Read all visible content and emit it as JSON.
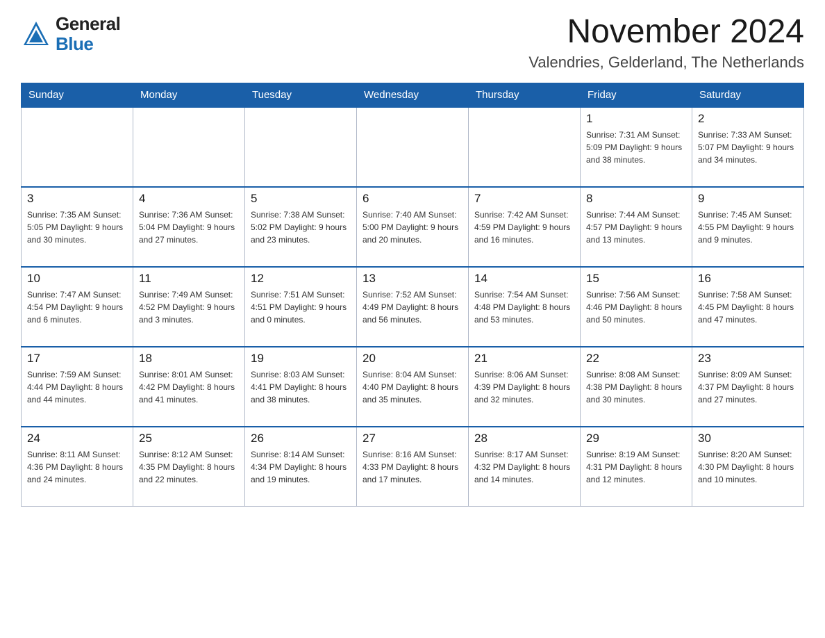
{
  "logo": {
    "line1": "General",
    "line2": "Blue"
  },
  "header": {
    "month_year": "November 2024",
    "location": "Valendries, Gelderland, The Netherlands"
  },
  "days_of_week": [
    "Sunday",
    "Monday",
    "Tuesday",
    "Wednesday",
    "Thursday",
    "Friday",
    "Saturday"
  ],
  "weeks": [
    {
      "days": [
        {
          "number": "",
          "info": ""
        },
        {
          "number": "",
          "info": ""
        },
        {
          "number": "",
          "info": ""
        },
        {
          "number": "",
          "info": ""
        },
        {
          "number": "",
          "info": ""
        },
        {
          "number": "1",
          "info": "Sunrise: 7:31 AM\nSunset: 5:09 PM\nDaylight: 9 hours\nand 38 minutes."
        },
        {
          "number": "2",
          "info": "Sunrise: 7:33 AM\nSunset: 5:07 PM\nDaylight: 9 hours\nand 34 minutes."
        }
      ]
    },
    {
      "days": [
        {
          "number": "3",
          "info": "Sunrise: 7:35 AM\nSunset: 5:05 PM\nDaylight: 9 hours\nand 30 minutes."
        },
        {
          "number": "4",
          "info": "Sunrise: 7:36 AM\nSunset: 5:04 PM\nDaylight: 9 hours\nand 27 minutes."
        },
        {
          "number": "5",
          "info": "Sunrise: 7:38 AM\nSunset: 5:02 PM\nDaylight: 9 hours\nand 23 minutes."
        },
        {
          "number": "6",
          "info": "Sunrise: 7:40 AM\nSunset: 5:00 PM\nDaylight: 9 hours\nand 20 minutes."
        },
        {
          "number": "7",
          "info": "Sunrise: 7:42 AM\nSunset: 4:59 PM\nDaylight: 9 hours\nand 16 minutes."
        },
        {
          "number": "8",
          "info": "Sunrise: 7:44 AM\nSunset: 4:57 PM\nDaylight: 9 hours\nand 13 minutes."
        },
        {
          "number": "9",
          "info": "Sunrise: 7:45 AM\nSunset: 4:55 PM\nDaylight: 9 hours\nand 9 minutes."
        }
      ]
    },
    {
      "days": [
        {
          "number": "10",
          "info": "Sunrise: 7:47 AM\nSunset: 4:54 PM\nDaylight: 9 hours\nand 6 minutes."
        },
        {
          "number": "11",
          "info": "Sunrise: 7:49 AM\nSunset: 4:52 PM\nDaylight: 9 hours\nand 3 minutes."
        },
        {
          "number": "12",
          "info": "Sunrise: 7:51 AM\nSunset: 4:51 PM\nDaylight: 9 hours\nand 0 minutes."
        },
        {
          "number": "13",
          "info": "Sunrise: 7:52 AM\nSunset: 4:49 PM\nDaylight: 8 hours\nand 56 minutes."
        },
        {
          "number": "14",
          "info": "Sunrise: 7:54 AM\nSunset: 4:48 PM\nDaylight: 8 hours\nand 53 minutes."
        },
        {
          "number": "15",
          "info": "Sunrise: 7:56 AM\nSunset: 4:46 PM\nDaylight: 8 hours\nand 50 minutes."
        },
        {
          "number": "16",
          "info": "Sunrise: 7:58 AM\nSunset: 4:45 PM\nDaylight: 8 hours\nand 47 minutes."
        }
      ]
    },
    {
      "days": [
        {
          "number": "17",
          "info": "Sunrise: 7:59 AM\nSunset: 4:44 PM\nDaylight: 8 hours\nand 44 minutes."
        },
        {
          "number": "18",
          "info": "Sunrise: 8:01 AM\nSunset: 4:42 PM\nDaylight: 8 hours\nand 41 minutes."
        },
        {
          "number": "19",
          "info": "Sunrise: 8:03 AM\nSunset: 4:41 PM\nDaylight: 8 hours\nand 38 minutes."
        },
        {
          "number": "20",
          "info": "Sunrise: 8:04 AM\nSunset: 4:40 PM\nDaylight: 8 hours\nand 35 minutes."
        },
        {
          "number": "21",
          "info": "Sunrise: 8:06 AM\nSunset: 4:39 PM\nDaylight: 8 hours\nand 32 minutes."
        },
        {
          "number": "22",
          "info": "Sunrise: 8:08 AM\nSunset: 4:38 PM\nDaylight: 8 hours\nand 30 minutes."
        },
        {
          "number": "23",
          "info": "Sunrise: 8:09 AM\nSunset: 4:37 PM\nDaylight: 8 hours\nand 27 minutes."
        }
      ]
    },
    {
      "days": [
        {
          "number": "24",
          "info": "Sunrise: 8:11 AM\nSunset: 4:36 PM\nDaylight: 8 hours\nand 24 minutes."
        },
        {
          "number": "25",
          "info": "Sunrise: 8:12 AM\nSunset: 4:35 PM\nDaylight: 8 hours\nand 22 minutes."
        },
        {
          "number": "26",
          "info": "Sunrise: 8:14 AM\nSunset: 4:34 PM\nDaylight: 8 hours\nand 19 minutes."
        },
        {
          "number": "27",
          "info": "Sunrise: 8:16 AM\nSunset: 4:33 PM\nDaylight: 8 hours\nand 17 minutes."
        },
        {
          "number": "28",
          "info": "Sunrise: 8:17 AM\nSunset: 4:32 PM\nDaylight: 8 hours\nand 14 minutes."
        },
        {
          "number": "29",
          "info": "Sunrise: 8:19 AM\nSunset: 4:31 PM\nDaylight: 8 hours\nand 12 minutes."
        },
        {
          "number": "30",
          "info": "Sunrise: 8:20 AM\nSunset: 4:30 PM\nDaylight: 8 hours\nand 10 minutes."
        }
      ]
    }
  ]
}
